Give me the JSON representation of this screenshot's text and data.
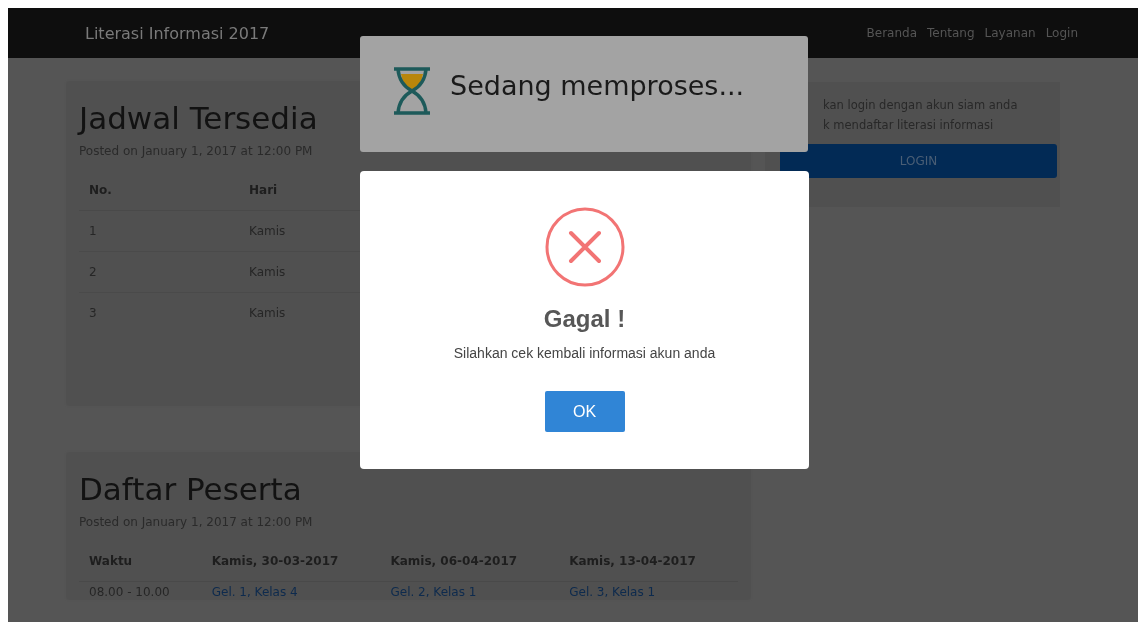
{
  "navbar": {
    "brand": "Literasi Informasi 2017",
    "links": [
      {
        "label": "Beranda"
      },
      {
        "label": "Tentang"
      },
      {
        "label": "Layanan"
      },
      {
        "label": "Login"
      }
    ]
  },
  "schedule": {
    "title": "Jadwal Tersedia",
    "posted": "Posted on January 1, 2017 at 12:00 PM",
    "columns": [
      "No.",
      "Hari"
    ],
    "rows": [
      [
        "1",
        "Kamis"
      ],
      [
        "2",
        "Kamis"
      ],
      [
        "3",
        "Kamis"
      ]
    ]
  },
  "participants": {
    "title": "Daftar Peserta",
    "posted": "Posted on January 1, 2017 at 12:00 PM",
    "columns": [
      "Waktu",
      "Kamis, 30-03-2017",
      "Kamis, 06-04-2017",
      "Kamis, 13-04-2017"
    ],
    "rows": [
      [
        "08.00 - 10.00",
        "Gel. 1, Kelas 4",
        "Gel. 2, Kelas 1",
        "Gel. 3, Kelas 1"
      ]
    ]
  },
  "login_panel": {
    "lines": [
      "kan login dengan akun siam anda",
      "k mendaftar literasi informasi"
    ],
    "button": "LOGIN"
  },
  "processing_toast": {
    "message": "Sedang memproses..."
  },
  "alert": {
    "title": "Gagal !",
    "message": "Silahkan cek kembali informasi akun anda",
    "button": "OK"
  }
}
